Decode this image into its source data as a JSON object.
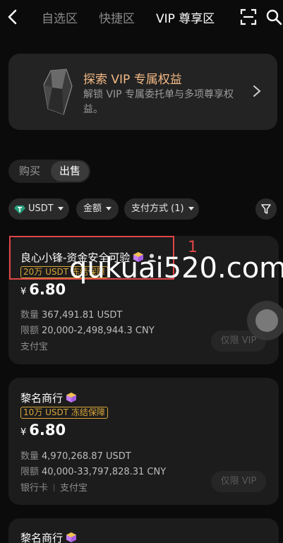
{
  "nav": {
    "tabs": [
      {
        "label": "自选区",
        "active": false
      },
      {
        "label": "快捷区",
        "active": false
      },
      {
        "label": "VIP 尊享区",
        "active": true
      }
    ]
  },
  "banner": {
    "title": "探索 VIP 专属权益",
    "description": "解锁 VIP 专属委托单与多项尊享权益。"
  },
  "side_toggle": {
    "buy_label": "购买",
    "sell_label": "出售",
    "selected": "出售"
  },
  "filters": {
    "coin": "USDT",
    "amount": "金额",
    "payment": "支付方式 (1)"
  },
  "labels": {
    "quantity": "数量",
    "limit": "限额",
    "currency_symbol": "¥",
    "vip_only": "仅限 VIP"
  },
  "ads": [
    {
      "merchant": "良心小锋-资金安全可验",
      "badge": "20万 USDT 冻结保障",
      "price": "6.80",
      "quantity": "367,491.81 USDT",
      "limit": "20,000-2,498,944.3 CNY",
      "payments": [
        "支付宝"
      ]
    },
    {
      "merchant": "黎名商行",
      "badge": "10万 USDT 冻结保障",
      "price": "6.80",
      "quantity": "4,970,268.87 USDT",
      "limit": "40,000-33,797,828.31 CNY",
      "payments": [
        "银行卡",
        "支付宝"
      ]
    },
    {
      "merchant": "黎名商行"
    }
  ],
  "annotation": {
    "number": "1",
    "color": "#e04545"
  },
  "watermark": "qukuai520.com",
  "colors": {
    "accent_gold": "#d9a63b",
    "banner_title": "#f3b985",
    "background": "#0b0b0b",
    "card": "#1c1c1c"
  }
}
